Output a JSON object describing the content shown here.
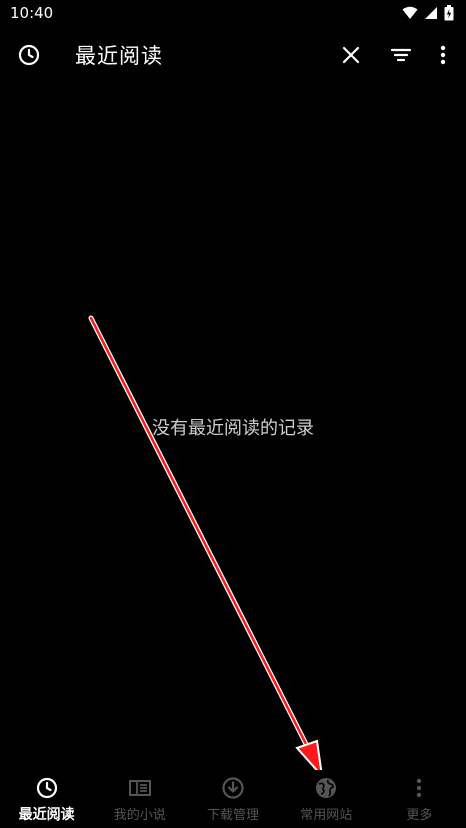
{
  "status_bar": {
    "time": "10:40"
  },
  "app_bar": {
    "title": "最近阅读"
  },
  "empty_state": {
    "message": "没有最近阅读的记录"
  },
  "bottom_nav": {
    "items": [
      {
        "label": "最近阅读",
        "icon": "clock-icon",
        "active": true
      },
      {
        "label": "我的小说",
        "icon": "book-icon",
        "active": false
      },
      {
        "label": "下载管理",
        "icon": "download-icon",
        "active": false
      },
      {
        "label": "常用网站",
        "icon": "globe-icon",
        "active": false
      },
      {
        "label": "更多",
        "icon": "more-vertical-icon",
        "active": false
      }
    ]
  },
  "colors": {
    "background": "#000000",
    "active": "#ffffff",
    "inactive": "#555555",
    "annotation_arrow": "#ff1a1a"
  }
}
